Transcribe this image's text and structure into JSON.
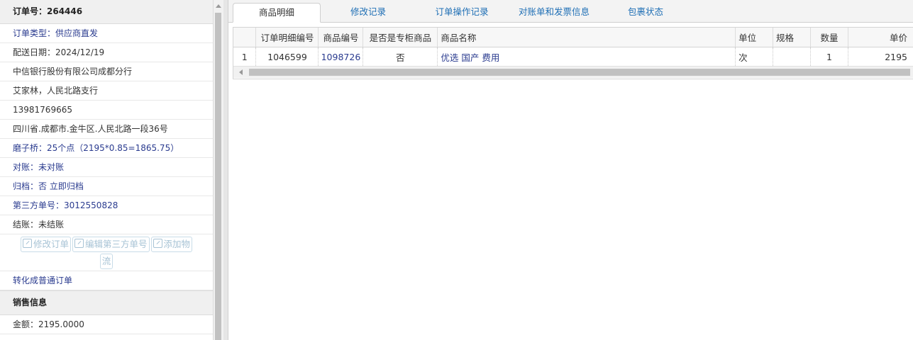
{
  "left": {
    "order_no": "订单号：264446",
    "rows": [
      {
        "text": "订单类型：供应商直发",
        "style": "blue"
      },
      {
        "text": "配送日期：2024/12/19",
        "style": "dark"
      },
      {
        "text": "中信银行股份有限公司成都分行",
        "style": "dark"
      },
      {
        "text": "艾家林，人民北路支行",
        "style": "dark"
      },
      {
        "text": "13981769665",
        "style": "dark"
      },
      {
        "text": "四川省.成都市.金牛区.人民北路一段36号",
        "style": "dark"
      },
      {
        "text": "磨子桥：25个点（2195*0.85=1865.75）",
        "style": "blue"
      },
      {
        "text": "对账：未对账",
        "style": "blue"
      },
      {
        "text": "归档：否 立即归档",
        "style": "blue"
      },
      {
        "text": "第三方单号：3012550828",
        "style": "blue"
      },
      {
        "text": "结账：未结账",
        "style": "dark"
      }
    ],
    "actions": {
      "modify_order": "修改订单",
      "edit_third_party": "编辑第三方单号",
      "add_logistics_1": "添加物",
      "add_logistics_2": "流"
    },
    "convert_link": "转化成普通订单",
    "sales_header": "销售信息",
    "amount": "金额：2195.0000"
  },
  "tabs": [
    {
      "label": "商品明细",
      "active": true
    },
    {
      "label": "修改记录",
      "active": false
    },
    {
      "label": "订单操作记录",
      "active": false
    },
    {
      "label": "对账单和发票信息",
      "active": false
    },
    {
      "label": "包裹状态",
      "active": false
    }
  ],
  "grid": {
    "headers": [
      "",
      "订单明细编号",
      "商品编号",
      "是否是专柜商品",
      "商品名称",
      "单位",
      "规格",
      "数量",
      "单价"
    ],
    "rows": [
      [
        "1",
        "1046599",
        "1098726",
        "否",
        "优选 国产 费用",
        "次",
        "",
        "1",
        "2195"
      ]
    ]
  },
  "colors": {
    "link_blue": "#2a3b8f",
    "tab_blue": "#1f6fb5",
    "disabled_btn": "#a7c3d5"
  }
}
